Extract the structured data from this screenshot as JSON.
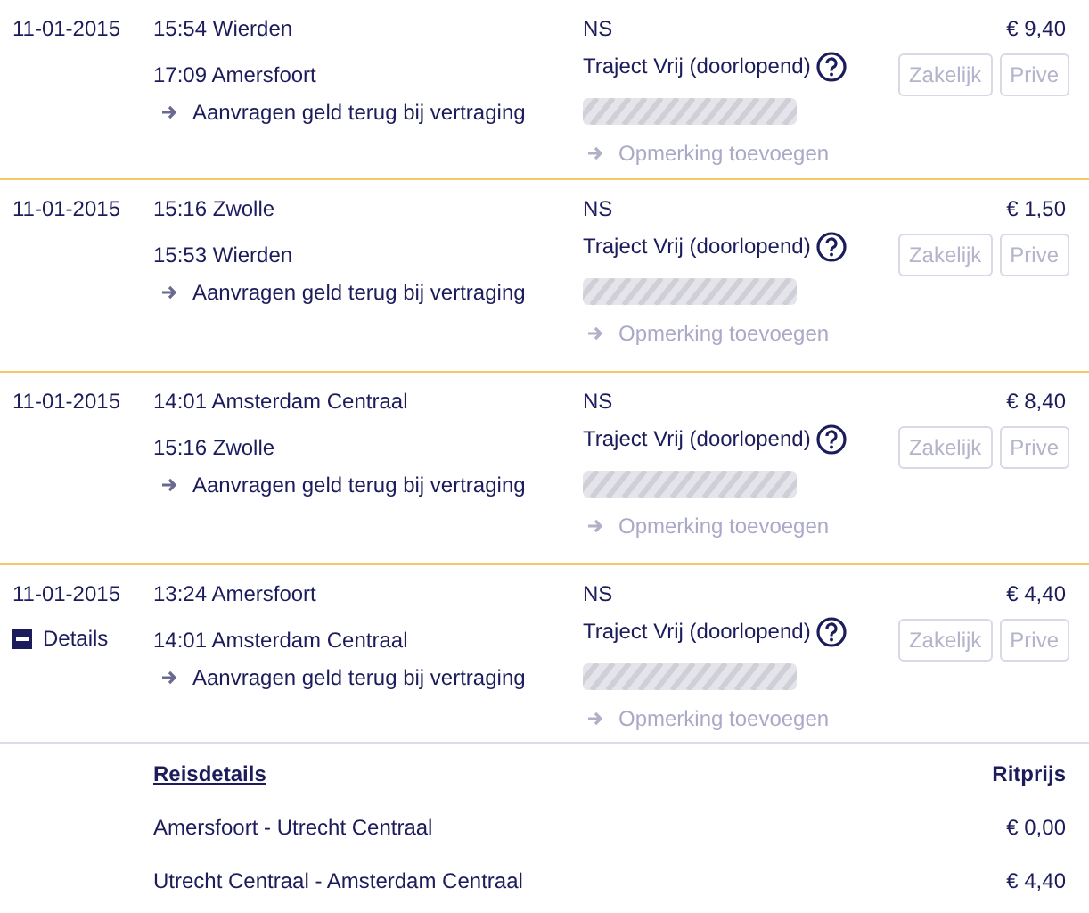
{
  "trips": [
    {
      "date": "11-01-2015",
      "departure": "15:54 Wierden",
      "arrival": "17:09 Amersfoort",
      "refund_link": "Aanvragen geld terug bij vertraging",
      "operator": "NS",
      "product": "Traject Vrij (doorlopend)",
      "price": "€ 9,40",
      "buttons": [
        {
          "label": "Zakelijk",
          "disabled": true
        },
        {
          "label": "Prive",
          "disabled": true
        }
      ],
      "remark_link": {
        "label": "Opmerking toevoegen",
        "disabled": true
      }
    },
    {
      "date": "11-01-2015",
      "departure": "15:16 Zwolle",
      "arrival": "15:53 Wierden",
      "refund_link": "Aanvragen geld terug bij vertraging",
      "operator": "NS",
      "product": "Traject Vrij (doorlopend)",
      "price": "€ 1,50",
      "buttons": [
        {
          "label": "Zakelijk",
          "disabled": true
        },
        {
          "label": "Prive",
          "disabled": true
        }
      ],
      "remark_link": {
        "label": "Opmerking toevoegen",
        "disabled": true
      }
    },
    {
      "date": "11-01-2015",
      "departure": "14:01 Amsterdam Centraal",
      "arrival": "15:16 Zwolle",
      "refund_link": "Aanvragen geld terug bij vertraging",
      "operator": "NS",
      "product": "Traject Vrij (doorlopend)",
      "price": "€ 8,40",
      "buttons": [
        {
          "label": "Zakelijk",
          "disabled": true
        },
        {
          "label": "Prive",
          "disabled": true
        }
      ],
      "remark_link": {
        "label": "Opmerking toevoegen",
        "disabled": true
      }
    },
    {
      "date": "11-01-2015",
      "details_toggle": {
        "label": "Details",
        "expanded": true
      },
      "departure": "13:24 Amersfoort",
      "arrival": "14:01 Amsterdam Centraal",
      "refund_link": "Aanvragen geld terug bij vertraging",
      "operator": "NS",
      "product": "Traject Vrij (doorlopend)",
      "price": "€ 4,40",
      "buttons": [
        {
          "label": "Zakelijk",
          "disabled": true
        },
        {
          "label": "Prive",
          "disabled": true
        }
      ],
      "remark_link": {
        "label": "Opmerking toevoegen",
        "disabled": true
      },
      "details": {
        "heading": "Reisdetails",
        "price_heading": "Ritprijs",
        "legs": [
          {
            "route": "Amersfoort - Utrecht Centraal",
            "price": "€ 0,00"
          },
          {
            "route": "Utrecht Centraal - Amsterdam Centraal",
            "price": "€ 4,40"
          }
        ]
      }
    }
  ]
}
